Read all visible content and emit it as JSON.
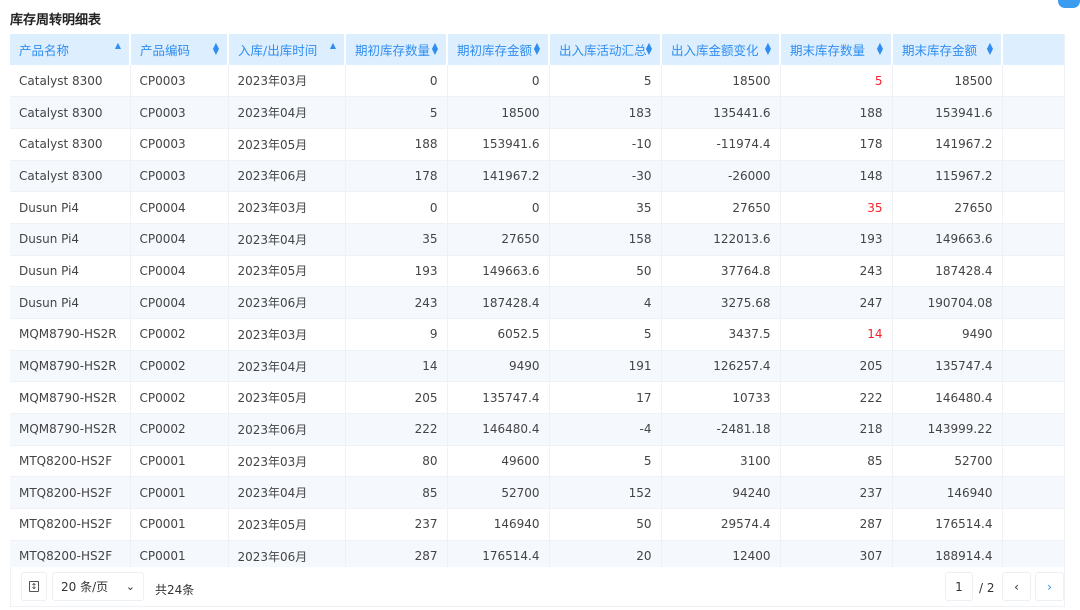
{
  "title": "库存周转明细表",
  "columns": [
    {
      "label": "产品名称",
      "sort": "asc"
    },
    {
      "label": "产品编码",
      "sort": "both"
    },
    {
      "label": "入库/出库时间",
      "sort": "asc"
    },
    {
      "label": "期初库存数量",
      "sort": "both"
    },
    {
      "label": "期初库存金额",
      "sort": "both"
    },
    {
      "label": "出入库活动汇总",
      "sort": "both"
    },
    {
      "label": "出入库金额变化",
      "sort": "both"
    },
    {
      "label": "期末库存数量",
      "sort": "both"
    },
    {
      "label": "期末库存金额",
      "sort": "both"
    }
  ],
  "rows": [
    [
      "Catalyst 8300",
      "CP0003",
      "2023年03月",
      "0",
      "0",
      "5",
      "18500",
      "5",
      "18500"
    ],
    [
      "Catalyst 8300",
      "CP0003",
      "2023年04月",
      "5",
      "18500",
      "183",
      "135441.6",
      "188",
      "153941.6"
    ],
    [
      "Catalyst 8300",
      "CP0003",
      "2023年05月",
      "188",
      "153941.6",
      "-10",
      "-11974.4",
      "178",
      "141967.2"
    ],
    [
      "Catalyst 8300",
      "CP0003",
      "2023年06月",
      "178",
      "141967.2",
      "-30",
      "-26000",
      "148",
      "115967.2"
    ],
    [
      "Dusun Pi4",
      "CP0004",
      "2023年03月",
      "0",
      "0",
      "35",
      "27650",
      "35",
      "27650"
    ],
    [
      "Dusun Pi4",
      "CP0004",
      "2023年04月",
      "35",
      "27650",
      "158",
      "122013.6",
      "193",
      "149663.6"
    ],
    [
      "Dusun Pi4",
      "CP0004",
      "2023年05月",
      "193",
      "149663.6",
      "50",
      "37764.8",
      "243",
      "187428.4"
    ],
    [
      "Dusun Pi4",
      "CP0004",
      "2023年06月",
      "243",
      "187428.4",
      "4",
      "3275.68",
      "247",
      "190704.08"
    ],
    [
      "MQM8790-HS2R",
      "CP0002",
      "2023年03月",
      "9",
      "6052.5",
      "5",
      "3437.5",
      "14",
      "9490"
    ],
    [
      "MQM8790-HS2R",
      "CP0002",
      "2023年04月",
      "14",
      "9490",
      "191",
      "126257.4",
      "205",
      "135747.4"
    ],
    [
      "MQM8790-HS2R",
      "CP0002",
      "2023年05月",
      "205",
      "135747.4",
      "17",
      "10733",
      "222",
      "146480.4"
    ],
    [
      "MQM8790-HS2R",
      "CP0002",
      "2023年06月",
      "222",
      "146480.4",
      "-4",
      "-2481.18",
      "218",
      "143999.22"
    ],
    [
      "MTQ8200-HS2F",
      "CP0001",
      "2023年03月",
      "80",
      "49600",
      "5",
      "3100",
      "85",
      "52700"
    ],
    [
      "MTQ8200-HS2F",
      "CP0001",
      "2023年04月",
      "85",
      "52700",
      "152",
      "94240",
      "237",
      "146940"
    ],
    [
      "MTQ8200-HS2F",
      "CP0001",
      "2023年05月",
      "237",
      "146940",
      "50",
      "29574.4",
      "287",
      "176514.4"
    ],
    [
      "MTQ8200-HS2F",
      "CP0001",
      "2023年06月",
      "287",
      "176514.4",
      "20",
      "12400",
      "307",
      "188914.4"
    ]
  ],
  "highlight_rows": [
    0,
    4,
    8
  ],
  "highlight_color": "#f5222d",
  "accent_color": "#2f8ef0",
  "pagination": {
    "page_size": "20 条/页",
    "total": "共24条",
    "current": "1",
    "pages": "/ 2"
  }
}
